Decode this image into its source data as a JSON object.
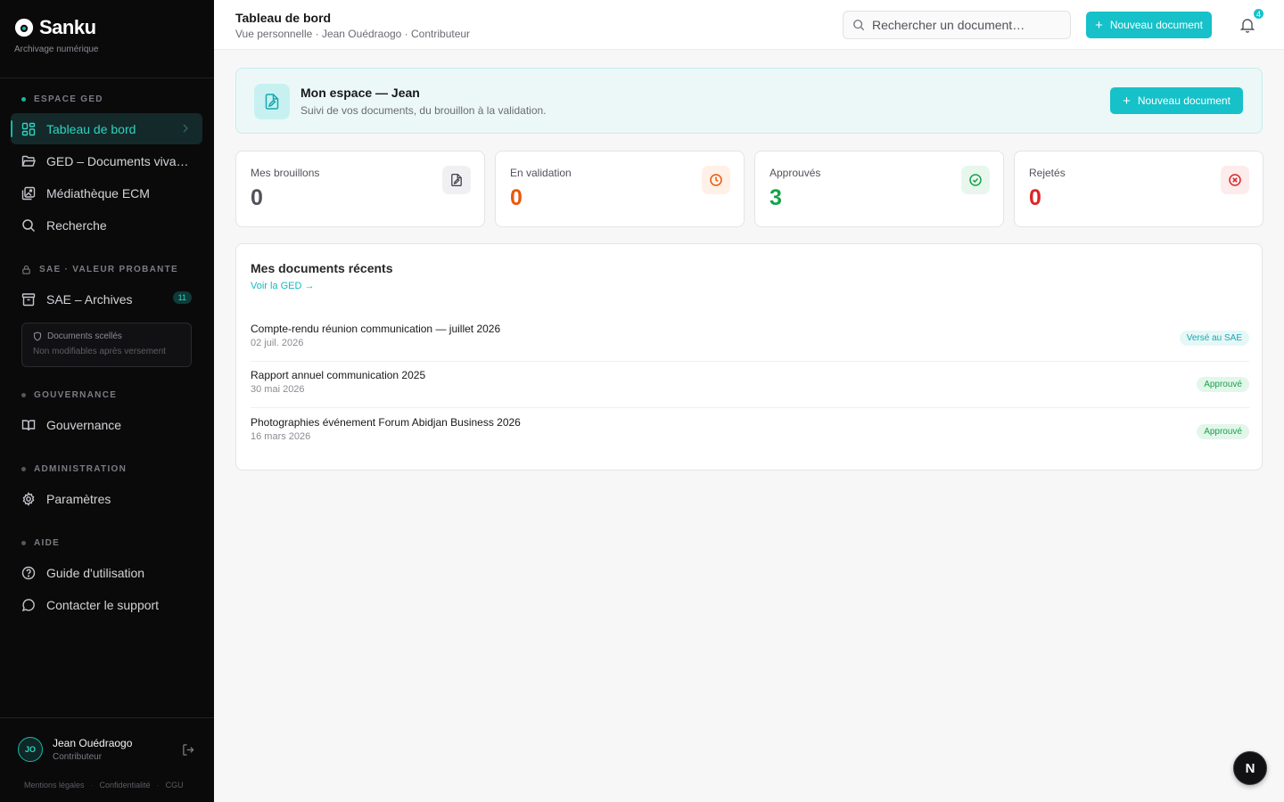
{
  "brand": {
    "name": "Sanku",
    "subtitle": "Archivage numérique"
  },
  "sidebar": {
    "sections": [
      {
        "label": "ESPACE GED"
      },
      {
        "label": "SAE · VALEUR PROBANTE"
      },
      {
        "label": "GOUVERNANCE"
      },
      {
        "label": "ADMINISTRATION"
      },
      {
        "label": "AIDE"
      }
    ],
    "items": [
      {
        "label": "Tableau de bord",
        "icon": "dashboard-icon",
        "active": true
      },
      {
        "label": "GED – Documents vivants",
        "icon": "folder-open-icon"
      },
      {
        "label": "Médiathèque ECM",
        "icon": "images-icon"
      },
      {
        "label": "Recherche",
        "icon": "search-icon"
      },
      {
        "label": "SAE – Archives",
        "icon": "archive-icon",
        "badge": "11"
      },
      {
        "label": "Gouvernance",
        "icon": "book-open-icon"
      },
      {
        "label": "Paramètres",
        "icon": "gear-icon"
      },
      {
        "label": "Guide d'utilisation",
        "icon": "help-circle-icon"
      },
      {
        "label": "Contacter le support",
        "icon": "chat-bubble-icon"
      }
    ],
    "sealed": {
      "title": "Documents scellés",
      "subtitle": "Non modifiables après versement"
    }
  },
  "user": {
    "initials": "JO",
    "name": "Jean Ouédraogo",
    "role": "Contributeur"
  },
  "footer_links": [
    "Mentions légales",
    "Confidentialité",
    "CGU"
  ],
  "header": {
    "title": "Tableau de bord",
    "subtitle": "Vue personnelle · Jean Ouédraogo · Contributeur",
    "search_placeholder": "Rechercher un document…",
    "new_button": "Nouveau document",
    "notifications": "4"
  },
  "welcome": {
    "title": "Mon espace — Jean",
    "subtitle": "Suivi de vos documents, du brouillon à la validation.",
    "button": "Nouveau document"
  },
  "stats": [
    {
      "label": "Mes brouillons",
      "value": "0",
      "color": "#52525b",
      "icon": "file-edit-icon"
    },
    {
      "label": "En validation",
      "value": "0",
      "color": "#ea580c",
      "icon": "clock-icon"
    },
    {
      "label": "Approuvés",
      "value": "3",
      "color": "#16a34a",
      "icon": "check-circle-icon"
    },
    {
      "label": "Rejetés",
      "value": "0",
      "color": "#dc2626",
      "icon": "x-circle-icon"
    }
  ],
  "recent": {
    "title": "Mes documents récents",
    "link": "Voir la GED →",
    "docs": [
      {
        "title": "Compte-rendu réunion communication — juillet 2026",
        "date": "02 juil. 2026",
        "status": "Versé au SAE"
      },
      {
        "title": "Rapport annuel communication 2025",
        "date": "30 mai 2026",
        "status": "Approuvé"
      },
      {
        "title": "Photographies événement Forum Abidjan Business 2026",
        "date": "16 mars 2026",
        "status": "Approuvé"
      }
    ]
  },
  "dev_badge": "N",
  "colors": {
    "accent": "#16c1c9",
    "sidebar_bg": "#0a0a0b",
    "active_text": "#2dd4bf"
  }
}
